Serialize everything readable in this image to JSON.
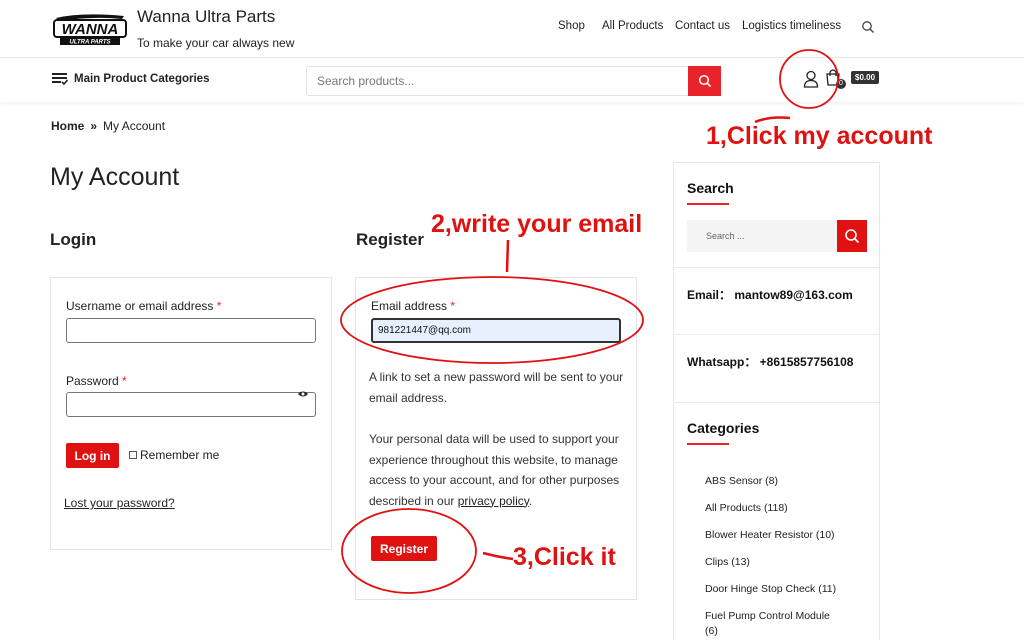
{
  "header": {
    "logo_text": "WANNA ULTRA PARTS",
    "site_title": "Wanna Ultra Parts",
    "site_tagline": "To make your car always new",
    "nav": [
      "Shop",
      "All Products",
      "Contact us",
      "Logistics timeliness"
    ]
  },
  "subheader": {
    "categories_menu_label": "Main Product Categories",
    "search_placeholder": "Search products...",
    "cart_count": "0",
    "cart_total": "$0.00"
  },
  "breadcrumb": {
    "home": "Home",
    "separator": "»",
    "current": "My Account"
  },
  "page_title": "My Account",
  "login": {
    "title": "Login",
    "username_label": "Username or email address",
    "required_mark": "*",
    "password_label": "Password",
    "login_button": "Log in",
    "remember_me": "Remember me",
    "lost_password": "Lost your password?"
  },
  "register": {
    "title": "Register",
    "email_label": "Email address",
    "required_mark": "*",
    "email_value": "981221447@qq.com",
    "password_note": "A link to set a new password will be sent to your email address.",
    "privacy_text": "Your personal data will be used to support your experience throughout this website, to manage access to your account, and for other purposes described in our",
    "privacy_link": "privacy policy",
    "privacy_end": ".",
    "register_button": "Register"
  },
  "sidebar": {
    "search_title": "Search",
    "search_placeholder": "Search ...",
    "email_line": "Email： mantow89@163.com",
    "whatsapp_line": "Whatsapp： +8615857756108",
    "categories_title": "Categories",
    "categories": [
      "ABS Sensor (8)",
      "All Products (118)",
      "Blower Heater Resistor (10)",
      "Clips (13)",
      "Door Hinge Stop Check (11)",
      "Fuel Pump Control Module (6)"
    ]
  },
  "annotations": {
    "step1": "1,Click my account",
    "step2": "2,write your email",
    "step3": "3,Click it"
  },
  "colors": {
    "accent": "#e9232a",
    "annotation": "#e01111",
    "dark_badge": "#333333"
  }
}
